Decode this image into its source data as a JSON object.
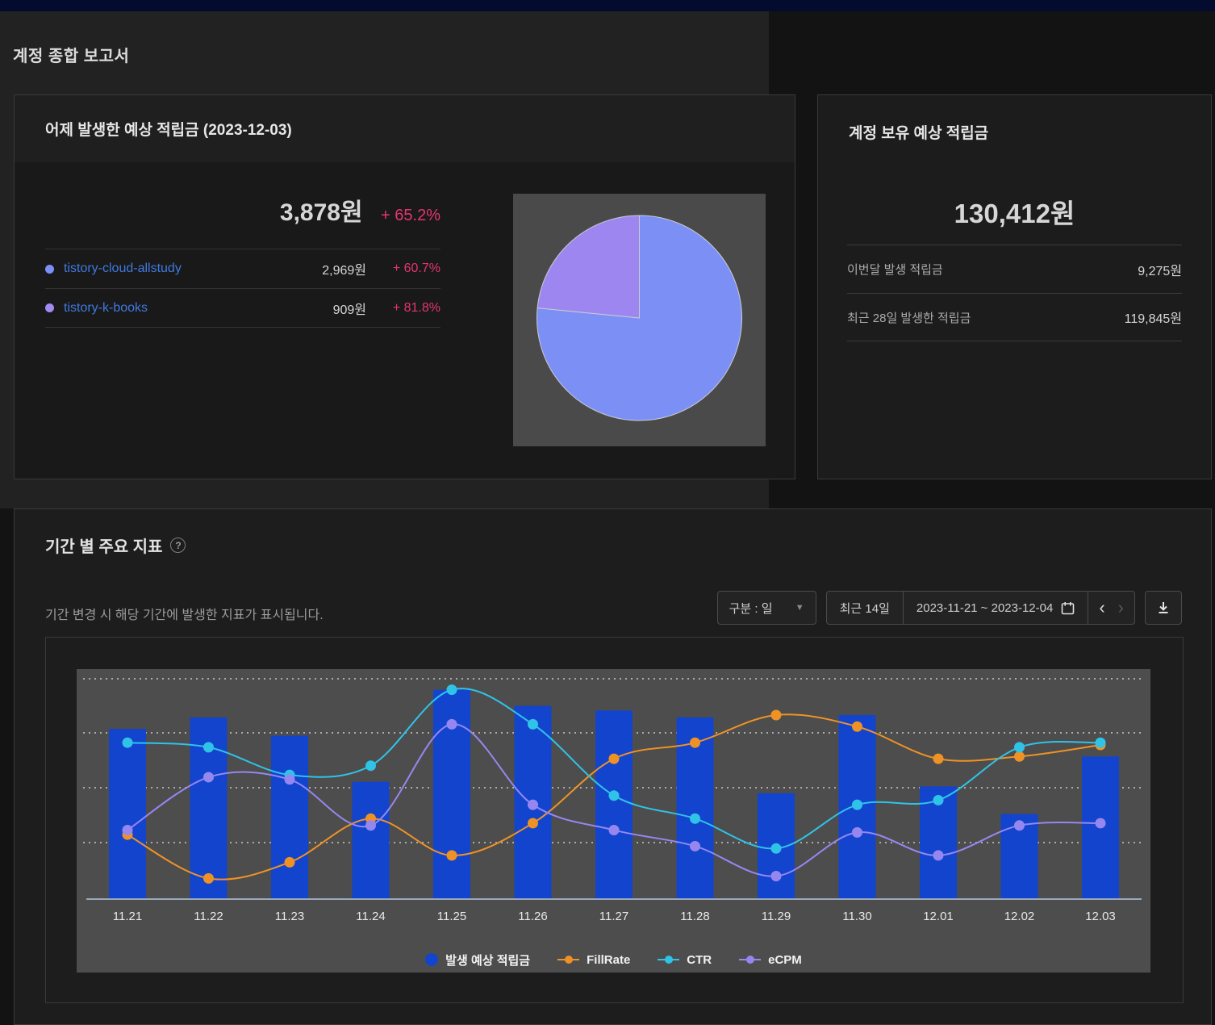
{
  "page": {
    "title": "계정 종합 보고서"
  },
  "yesterday_card": {
    "title": "어제 발생한 예상 적립금 (2023-12-03)",
    "total": "3,878원",
    "total_change": "+ 65.2%",
    "items": [
      {
        "name": "tistory-cloud-allstudy",
        "value": "2,969원",
        "change": "+ 60.7%",
        "color": "#7c8ff5"
      },
      {
        "name": "tistory-k-books",
        "value": "909원",
        "change": "+ 81.8%",
        "color": "#a18bf2"
      }
    ]
  },
  "balance_card": {
    "title": "계정 보유 예상 적립금",
    "total": "130,412원",
    "rows": [
      {
        "label": "이번달 발생 적립금",
        "value": "9,275원"
      },
      {
        "label": "최근 28일 발생한 적립금",
        "value": "119,845원"
      }
    ]
  },
  "metrics_section": {
    "title": "기간 별 주요 지표",
    "help_icon": "?",
    "description": "기간 변경 시 해당 기간에 발생한 지표가 표시됩니다.",
    "unit_select_label": "구분 : 일",
    "range_preset_label": "최근 14일",
    "date_range_label": "2023-11-21 ~ 2023-12-04",
    "prev_label": "‹",
    "next_label": "›"
  },
  "chart_data": [
    {
      "type": "pie",
      "title": "어제 발생한 예상 적립금 구성",
      "labels": [
        "tistory-cloud-allstudy",
        "tistory-k-books"
      ],
      "values": [
        2969,
        909
      ],
      "colors": [
        "#7c8ff5",
        "#9e86f0"
      ],
      "start": "top-clockwise",
      "legend_position": "none"
    },
    {
      "type": "combo",
      "title": "기간 별 주요 지표",
      "categories": [
        "11.21",
        "11.22",
        "11.23",
        "11.24",
        "11.25",
        "11.26",
        "11.27",
        "11.28",
        "11.29",
        "11.30",
        "12.01",
        "12.02",
        "12.03"
      ],
      "series": [
        {
          "name": "발생 예상 적립금",
          "kind": "bar",
          "color": "#1244ce",
          "values": [
            74,
            79,
            71,
            51,
            91,
            84,
            82,
            79,
            46,
            80,
            49,
            37,
            62
          ]
        },
        {
          "name": "FillRate",
          "kind": "line",
          "color": "#ef9226",
          "values": [
            28,
            9,
            16,
            35,
            19,
            33,
            61,
            68,
            80,
            75,
            61,
            62,
            67
          ]
        },
        {
          "name": "CTR",
          "kind": "line",
          "color": "#30c3e8",
          "values": [
            68,
            66,
            54,
            58,
            91,
            76,
            45,
            35,
            22,
            41,
            43,
            66,
            68
          ]
        },
        {
          "name": "eCPM",
          "kind": "line",
          "color": "#9687f0",
          "values": [
            30,
            53,
            52,
            32,
            76,
            41,
            30,
            23,
            10,
            29,
            19,
            32,
            33
          ]
        }
      ],
      "ylim": [
        0,
        100
      ],
      "y_axis_labels": "none",
      "grid": "dotted-horizontal",
      "legend_position": "bottom"
    }
  ]
}
